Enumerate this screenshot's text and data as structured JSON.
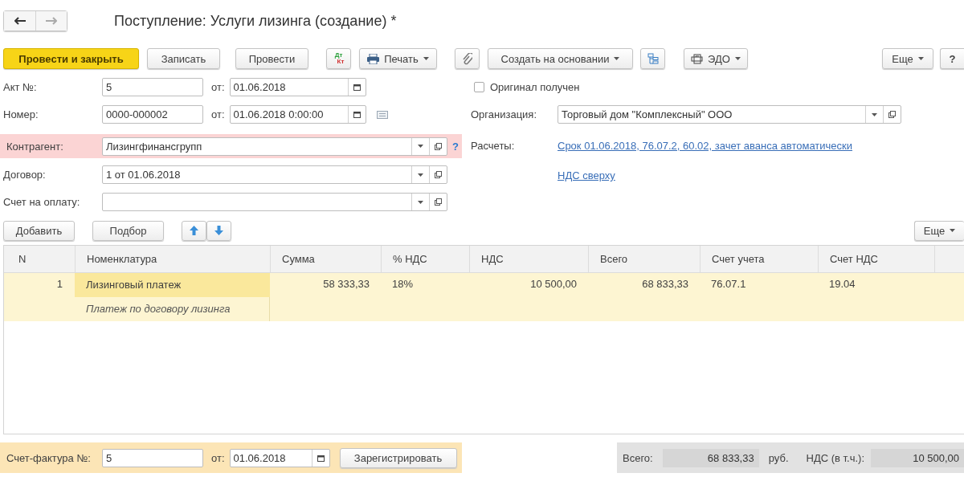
{
  "title": "Поступление: Услуги лизинга (создание) *",
  "toolbar": [
    {
      "kind": "primary",
      "label": "Провести и закрыть"
    },
    {
      "kind": "button",
      "label": "Записать"
    },
    {
      "kind": "button",
      "label": "Провести"
    },
    {
      "kind": "postings",
      "top": "Дт",
      "bottom": "Кт"
    },
    {
      "kind": "print",
      "label": "Печать"
    },
    {
      "kind": "attach"
    },
    {
      "kind": "create",
      "label": "Создать на основании"
    },
    {
      "kind": "structure"
    },
    {
      "kind": "edo",
      "label": "ЭДО"
    },
    {
      "kind": "more",
      "label": "Еще"
    },
    {
      "kind": "help",
      "label": "?"
    }
  ],
  "number_fields": [
    {
      "kind": "date",
      "label": "Акт №:",
      "number": "5",
      "date_label": "от:",
      "date": "01.06.2018"
    },
    {
      "kind": "datetime",
      "label": "Номер:",
      "number": "0000-000002",
      "date_label": "от:",
      "date": "01.06.2018  0:00:00"
    }
  ],
  "ref_fields": [
    {
      "label": "Контрагент:",
      "value": "Лизингфинансгрупп",
      "highlighted": true,
      "help": "?"
    },
    {
      "label": "Договор:",
      "value": "1 от 01.06.2018",
      "highlighted": false
    },
    {
      "label": "Счет на оплату:",
      "highlighted": false
    }
  ],
  "original_received": {
    "label": "Оригинал получен",
    "checked": false
  },
  "organization": {
    "label": "Организация:",
    "value": "Торговый дом \"Комплексный\" ООО"
  },
  "settlements": {
    "label": "Расчеты:",
    "link": "Срок 01.06.2018, 76.07.2, 60.02, зачет аванса автоматически"
  },
  "vat_link": "НДС сверху",
  "table_toolbar": {
    "add": "Добавить",
    "pick": "Подбор",
    "more": "Еще"
  },
  "table": {
    "columns": [
      "N",
      "Номенклатура",
      "Сумма",
      "% НДС",
      "НДС",
      "Всего",
      "Счет учета",
      "Счет НДС"
    ],
    "rows": [
      {
        "selected": true,
        "n": "1",
        "item": "Лизинговый платеж",
        "content": "Платеж по договору лизинга",
        "sum": "58 333,33",
        "vat_rate": "18%",
        "vat": "10 500,00",
        "total": "68 833,33",
        "account": "76.07.1",
        "vat_account": "19.04"
      }
    ]
  },
  "invoice": {
    "label": "Счет-фактура №:",
    "number": "5",
    "date_label": "от:",
    "date": "01.06.2018",
    "button": "Зарегистрировать"
  },
  "totals": {
    "total_label": "Всего:",
    "total": "68 833,33",
    "currency": "руб.",
    "vat_label": "НДС (в т.ч.):",
    "vat": "10 500,00"
  }
}
